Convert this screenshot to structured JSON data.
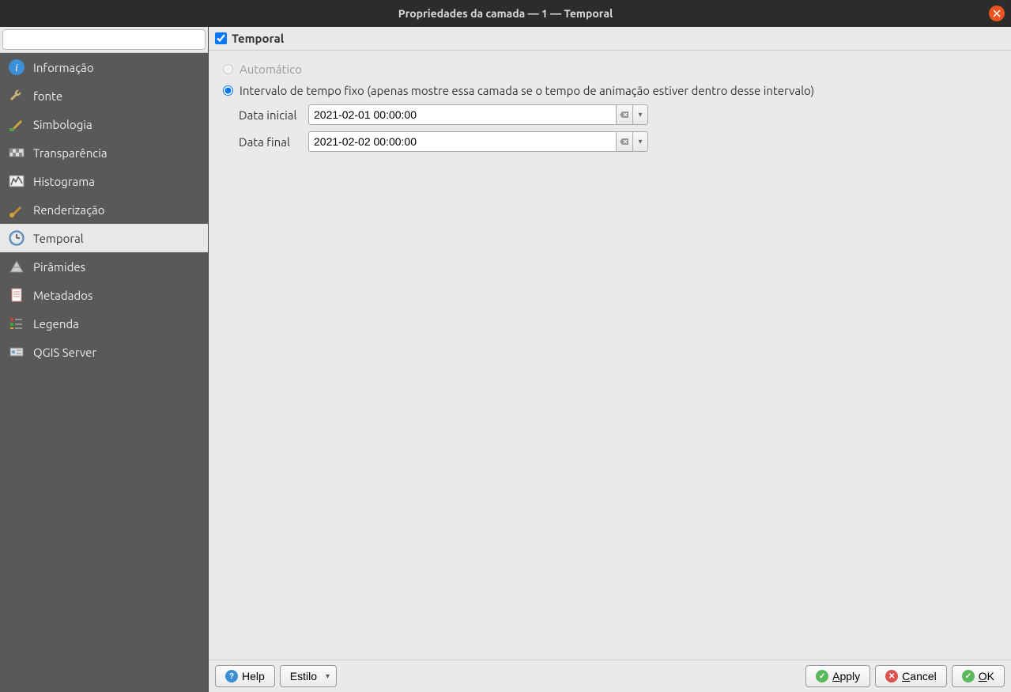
{
  "title": "Propriedades da camada — 1 — Temporal",
  "search": {
    "placeholder": ""
  },
  "sidebar": {
    "items": [
      {
        "label": "Informação"
      },
      {
        "label": "fonte"
      },
      {
        "label": "Simbologia"
      },
      {
        "label": "Transparência"
      },
      {
        "label": "Histograma"
      },
      {
        "label": "Renderização"
      },
      {
        "label": "Temporal"
      },
      {
        "label": "Pirâmides"
      },
      {
        "label": "Metadados"
      },
      {
        "label": "Legenda"
      },
      {
        "label": "QGIS Server"
      }
    ]
  },
  "section": {
    "checkbox_checked": true,
    "title": "Temporal"
  },
  "radios": {
    "auto_label": "Automático",
    "fixed_label": "Intervalo de tempo fixo (apenas mostre essa camada se o tempo de animação estiver dentro desse intervalo)"
  },
  "fields": {
    "start_label": "Data inicial",
    "start_value": "2021-02-01 00:00:00",
    "end_label": "Data final",
    "end_value": "2021-02-02 00:00:00"
  },
  "footer": {
    "help": "Help",
    "style": "Estilo",
    "apply": "Apply",
    "cancel": "Cancel",
    "ok": "OK"
  }
}
